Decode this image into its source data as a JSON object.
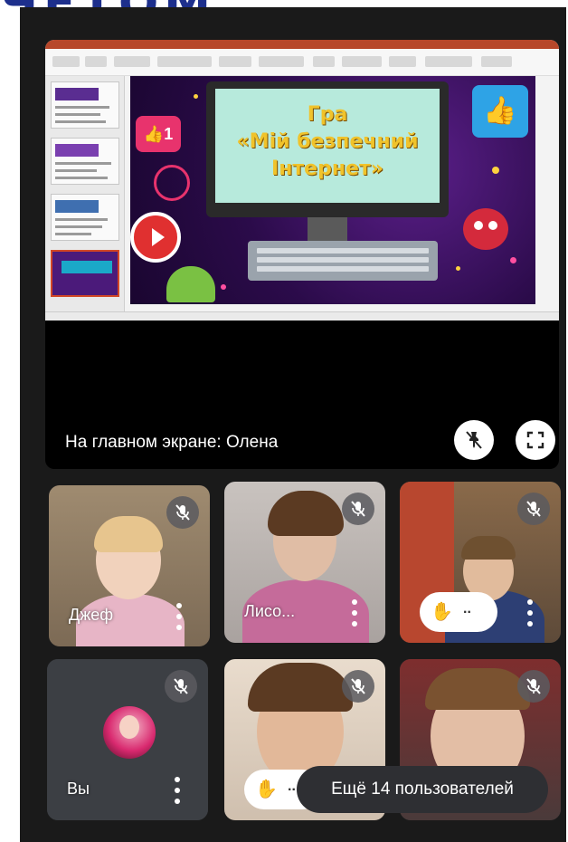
{
  "header": {
    "banner_text": "ЧЕТОМ"
  },
  "slide": {
    "title_line1": "Гра",
    "title_line2": "«Мій безпечний",
    "title_line3": "Інтернет»",
    "like_count": "1"
  },
  "stage": {
    "label": "На главном экране: Олена",
    "pin_icon": "pin-off-icon",
    "fullscreen_icon": "fullscreen-icon"
  },
  "participants": [
    {
      "name": "Джеф",
      "muted": true
    },
    {
      "name": "Лисо...",
      "muted": true
    },
    {
      "name": "",
      "muted": true,
      "hand_raised": true,
      "hand_dots": ".."
    },
    {
      "name": "Вы",
      "muted": true
    },
    {
      "name": "",
      "muted": true,
      "hand_raised": true,
      "hand_dots": ".."
    },
    {
      "name": "",
      "muted": true
    }
  ],
  "more_users": {
    "label": "Ещё 14 пользователей"
  },
  "colors": {
    "background": "#1a1a1a",
    "tile": "#3a3c40",
    "accent_pink": "#e8336d",
    "slide_purple": "#2b0b4a",
    "banner_blue": "#1d2f8c"
  }
}
